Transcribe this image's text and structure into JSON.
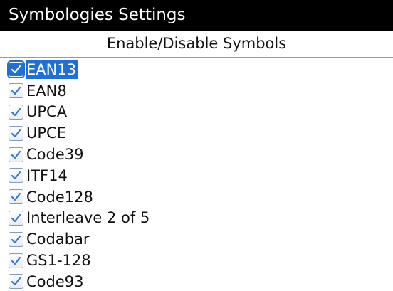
{
  "title": "Symbologies Settings",
  "subheader": "Enable/Disable Symbols",
  "selected_index": 0,
  "colors": {
    "title_bg": "#000000",
    "title_fg": "#ffffff",
    "selection": "#1f6fd6",
    "check": "#3a78c8"
  },
  "symbols": [
    {
      "label": "EAN13",
      "checked": true
    },
    {
      "label": "EAN8",
      "checked": true
    },
    {
      "label": "UPCA",
      "checked": true
    },
    {
      "label": "UPCE",
      "checked": true
    },
    {
      "label": "Code39",
      "checked": true
    },
    {
      "label": "ITF14",
      "checked": true
    },
    {
      "label": "Code128",
      "checked": true
    },
    {
      "label": "Interleave 2 of 5",
      "checked": true
    },
    {
      "label": "Codabar",
      "checked": true
    },
    {
      "label": "GS1-128",
      "checked": true
    },
    {
      "label": "Code93",
      "checked": true
    }
  ]
}
